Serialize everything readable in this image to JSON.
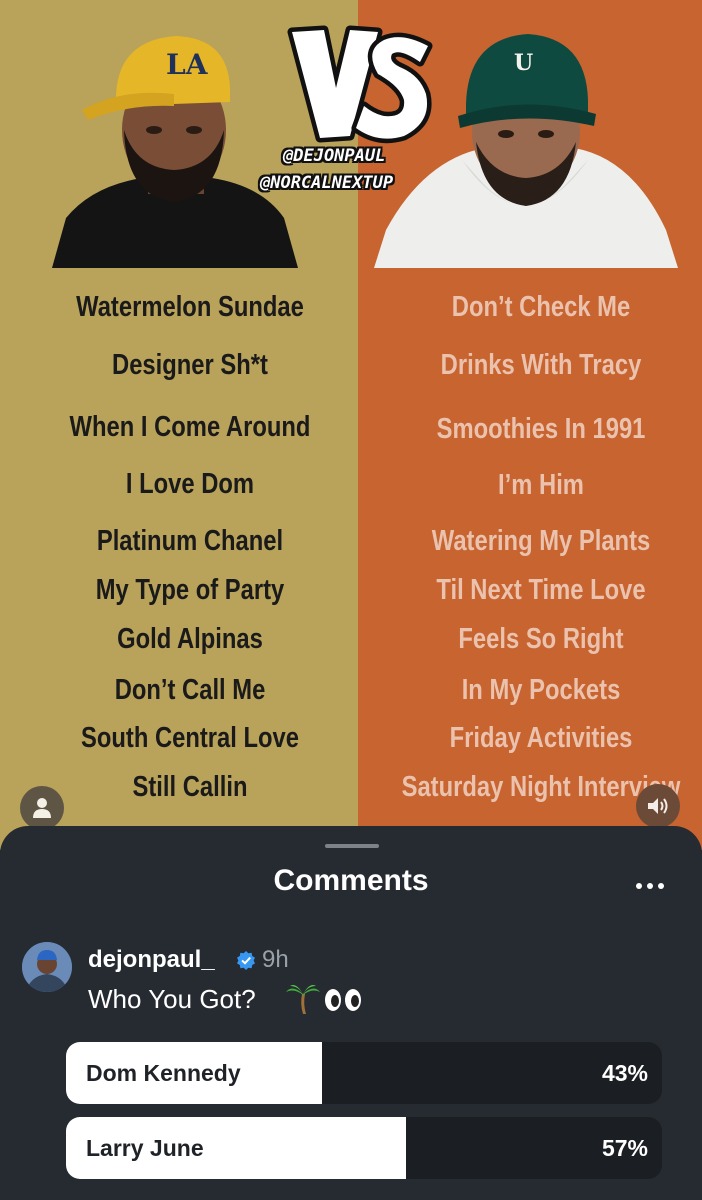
{
  "post": {
    "handles": [
      "@DEJONPAUL",
      "@NORCALNEXTUP"
    ],
    "left_songs": [
      "Watermelon Sundae",
      "Designer Sh*t",
      "When I Come Around",
      "I Love Dom",
      "Platinum Chanel",
      "My Type of Party",
      "Gold Alpinas",
      "Don’t Call Me",
      "South Central Love",
      "Still Callin"
    ],
    "right_songs": [
      "Don’t Check Me",
      "Drinks With Tracy",
      "Smoothies In 1991",
      "I’m Him",
      "Watering My Plants",
      "Til Next Time Love",
      "Feels So Right",
      "In My Pockets",
      "Friday Activities",
      "Saturday Night Interview"
    ],
    "colors": {
      "left_bg": "#b9a25a",
      "right_bg": "#c76430",
      "right_text": "#eac2ad"
    }
  },
  "comments_sheet": {
    "title": "Comments",
    "more_icon": "ellipsis-icon",
    "comment": {
      "username": "dejonpaul_",
      "verified": true,
      "time": "9h",
      "text": "Who You Got?",
      "emojis": [
        "palm-tree",
        "eyes"
      ]
    },
    "poll": {
      "options": [
        {
          "label": "Dom Kennedy",
          "percent_text": "43%",
          "percent": 43
        },
        {
          "label": "Larry June",
          "percent_text": "57%",
          "percent": 57
        }
      ]
    }
  }
}
